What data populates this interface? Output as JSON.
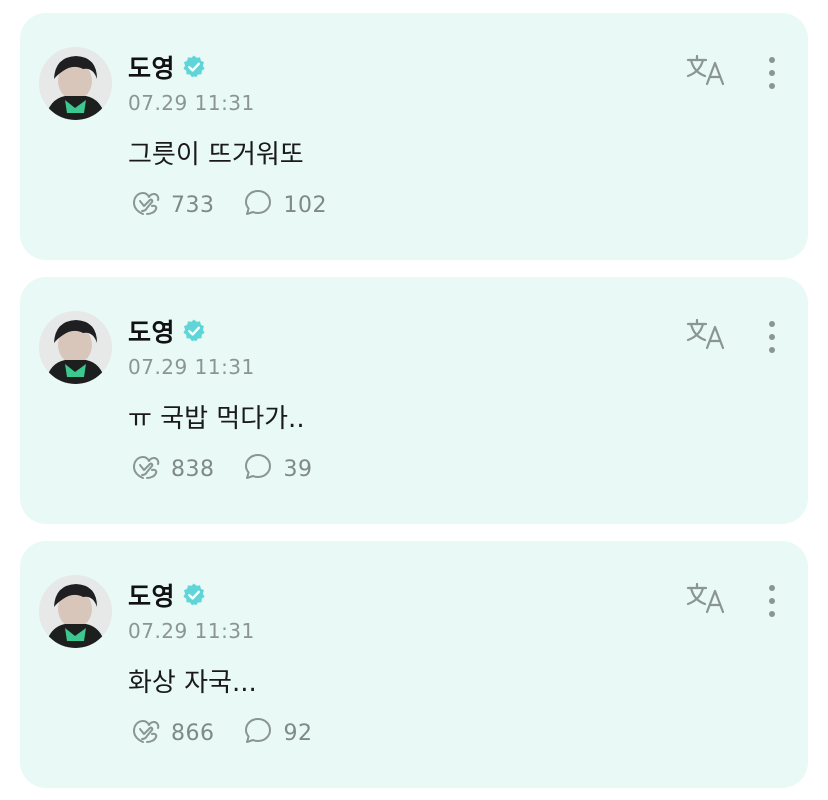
{
  "posts": [
    {
      "author": "도영",
      "timestamp": "07.29 11:31",
      "text": "그릇이 뜨거워또",
      "likes": "733",
      "comments": "102"
    },
    {
      "author": "도영",
      "timestamp": "07.29 11:31",
      "text": "ㅠ 국밥 먹다가..",
      "likes": "838",
      "comments": "39"
    },
    {
      "author": "도영",
      "timestamp": "07.29 11:31",
      "text": "화상 자국...",
      "likes": "866",
      "comments": "92"
    }
  ],
  "icons": {
    "verified": "verified-badge-icon",
    "translate": "translate-icon",
    "more": "more-vertical-icon",
    "like": "heart-hand-icon",
    "comment": "speech-bubble-icon"
  },
  "colors": {
    "card_background": "#e8f9f6",
    "verified_badge": "#5fd5d8",
    "icon_gray": "#8b9593"
  }
}
